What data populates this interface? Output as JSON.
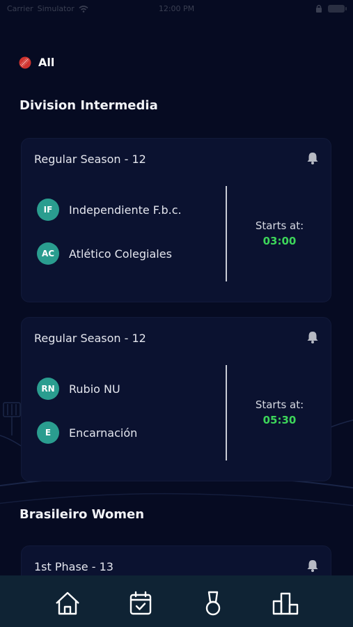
{
  "status_bar": {
    "carrier": "Carrier",
    "network": "Simulator",
    "time": "12:00 PM"
  },
  "filter": {
    "label": "All",
    "icon": "cricket-ball-icon"
  },
  "leagues": [
    {
      "title": "Division Intermedia",
      "matches": [
        {
          "round": "Regular Season - 12",
          "home": {
            "abbr": "IF",
            "name": "Independiente F.b.c."
          },
          "away": {
            "abbr": "AC",
            "name": "Atlético Colegiales"
          },
          "start_label": "Starts at:",
          "start_time": "03:00"
        },
        {
          "round": "Regular Season - 12",
          "home": {
            "abbr": "RN",
            "name": "Rubio NU"
          },
          "away": {
            "abbr": "E",
            "name": "Encarnación"
          },
          "start_label": "Starts at:",
          "start_time": "05:30"
        }
      ]
    },
    {
      "title": "Brasileiro Women",
      "matches": [
        {
          "round": "1st Phase - 13"
        }
      ]
    }
  ],
  "tabs": [
    {
      "name": "home-icon"
    },
    {
      "name": "calendar-check-icon"
    },
    {
      "name": "medal-icon"
    },
    {
      "name": "podium-icon"
    }
  ],
  "colors": {
    "background": "#060b22",
    "card": "#0b1230",
    "badge": "#2a9d8f",
    "time_accent": "#3dd65a",
    "tab_bar": "#0f2334",
    "ball": "#d0332f"
  }
}
